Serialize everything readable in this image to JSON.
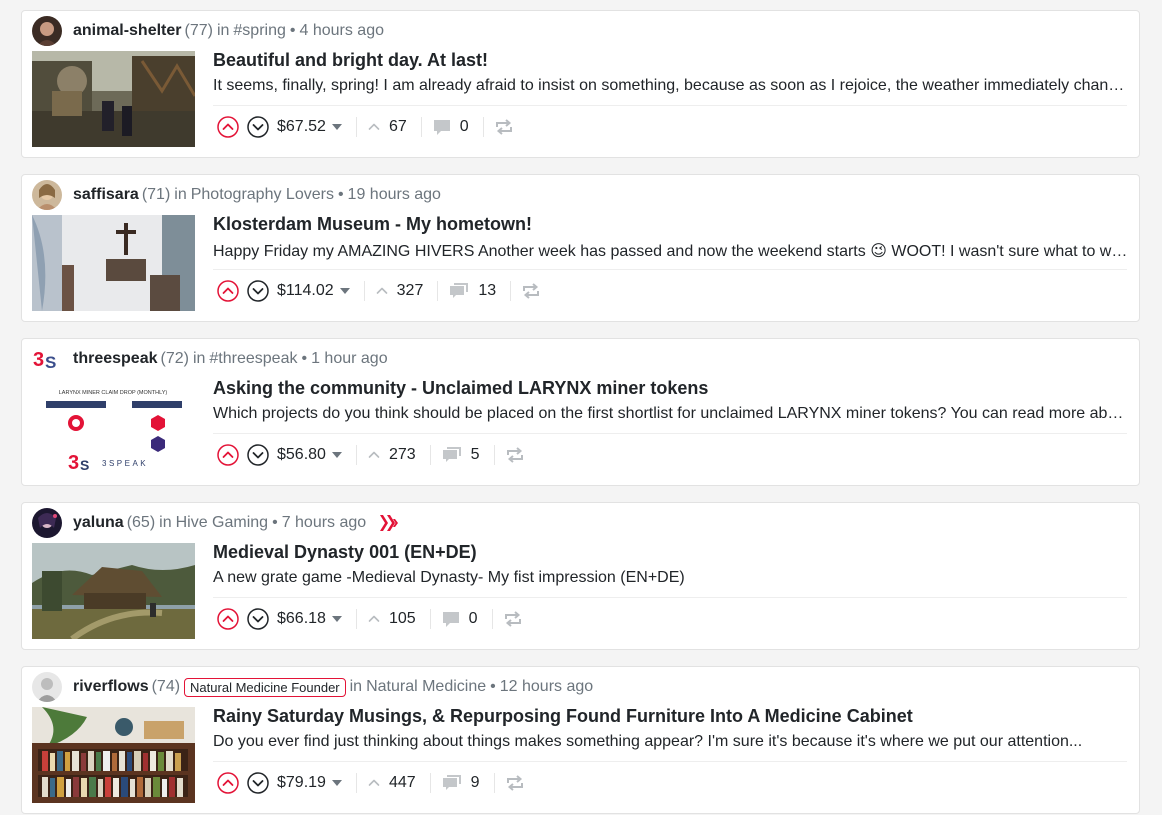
{
  "posts": [
    {
      "author": "animal-shelter",
      "reputation": "(77)",
      "in_label": "in",
      "community": "#spring",
      "age": "4 hours ago",
      "title": "Beautiful and bright day. At last!",
      "summary": "It seems, finally, spring! I am already afraid to insist on something, because as soon as I rejoice, the weather immediately changes...",
      "payout": "$67.52",
      "votes": "67",
      "comments": "0"
    },
    {
      "author": "saffisara",
      "reputation": "(71)",
      "in_label": "in",
      "community": "Photography Lovers",
      "age": "19 hours ago",
      "title": "Klosterdam Museum - My hometown!",
      "summary_a": "Happy Friday my AMAZING HIVERS Another week has passed and now the weekend starts",
      "summary_emoji": "😉",
      "summary_b": "WOOT! I wasn't sure what to write about today...",
      "payout": "$114.02",
      "votes": "327",
      "comments": "13"
    },
    {
      "author": "threespeak",
      "reputation": "(72)",
      "in_label": "in",
      "community": "#threespeak",
      "age": "1 hour ago",
      "title": "Asking the community - Unclaimed LARYNX miner tokens",
      "summary": "Which projects do you think should be placed on the first shortlist for unclaimed LARYNX miner tokens? You can read more about it...",
      "thumb_heading": "LARYNX MINER CLAIM DROP (MONTHLY)",
      "thumb_brand": "3SPEAK",
      "payout": "$56.80",
      "votes": "273",
      "comments": "5"
    },
    {
      "author": "yaluna",
      "reputation": "(65)",
      "in_label": "in",
      "community": "Hive Gaming",
      "age": "7 hours ago",
      "title": "Medieval Dynasty 001 (EN+DE)",
      "summary": "A new grate game -Medieval Dynasty- My fist impression (EN+DE)",
      "payout": "$66.18",
      "votes": "105",
      "comments": "0"
    },
    {
      "author": "riverflows",
      "reputation": "(74)",
      "badge": "Natural Medicine Founder",
      "in_label": "in",
      "community": "Natural Medicine",
      "age": "12 hours ago",
      "title": "Rainy Saturday Musings, & Repurposing Found Furniture Into A Medicine Cabinet",
      "summary": "Do you ever find just thinking about things makes something appear? I'm sure it's because it's where we put our attention...",
      "payout": "$79.19",
      "votes": "447",
      "comments": "9"
    }
  ],
  "separator": "•",
  "colors": {
    "accent": "#e31337",
    "muted": "#6c757d",
    "text": "#212529"
  },
  "icons": {
    "upvote": "upvote-icon",
    "downvote": "downvote-icon",
    "votes": "votes-chevron-icon",
    "comments": "comment-icon",
    "reblog": "reblog-icon",
    "caret": "caret-down-icon"
  }
}
